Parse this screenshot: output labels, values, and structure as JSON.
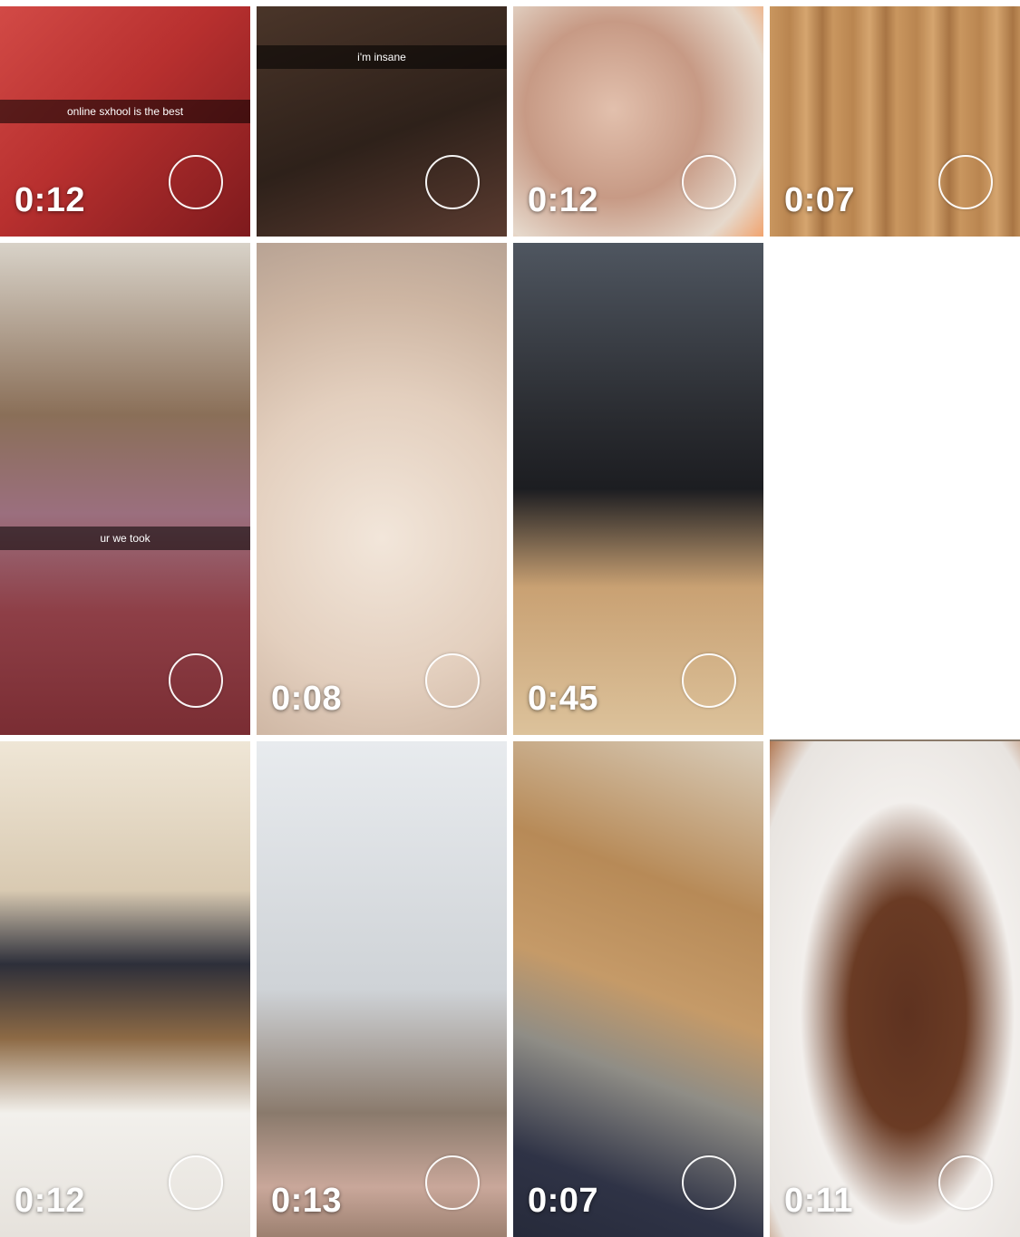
{
  "tiles": [
    {
      "name": "tile-red-shirt",
      "duration": "0:12",
      "caption": "online sxhool is the best",
      "colors": [
        "#c63a3a",
        "#8e1f22"
      ]
    },
    {
      "name": "tile-glasses-dark",
      "duration": "",
      "caption": "i'm insane",
      "colors": [
        "#3a2a22",
        "#1d1511"
      ]
    },
    {
      "name": "tile-blurry-face",
      "duration": "0:12",
      "caption": "",
      "colors": [
        "#d9b8a5",
        "#9e7d6b"
      ]
    },
    {
      "name": "tile-wood-floor",
      "duration": "0:07",
      "caption": "",
      "colors": [
        "#c79560",
        "#99683a"
      ]
    },
    {
      "name": "tile-mask-selfie",
      "duration": "",
      "caption": "ur we took",
      "colors": [
        "#7f6a58",
        "#8a4b54"
      ]
    },
    {
      "name": "tile-white-dog",
      "duration": "0:08",
      "caption": "",
      "colors": [
        "#e9d8c9",
        "#c8b09d"
      ]
    },
    {
      "name": "tile-black-dog",
      "duration": "0:45",
      "caption": "",
      "colors": [
        "#5f6670",
        "#c8a478"
      ]
    },
    {
      "name": "tile-tv-room",
      "duration": "0:12",
      "caption": "",
      "colors": [
        "#e6dccc",
        "#c5b49c"
      ]
    },
    {
      "name": "tile-car-ceiling",
      "duration": "0:13",
      "caption": "",
      "colors": [
        "#d4d8dc",
        "#7c7670"
      ]
    },
    {
      "name": "tile-kitchen",
      "duration": "0:07",
      "caption": "",
      "colors": [
        "#c19a6b",
        "#3f3f52"
      ]
    },
    {
      "name": "tile-chocolate",
      "duration": "0:11",
      "caption": "",
      "colors": [
        "#ece9e8",
        "#6a3b22"
      ]
    }
  ]
}
